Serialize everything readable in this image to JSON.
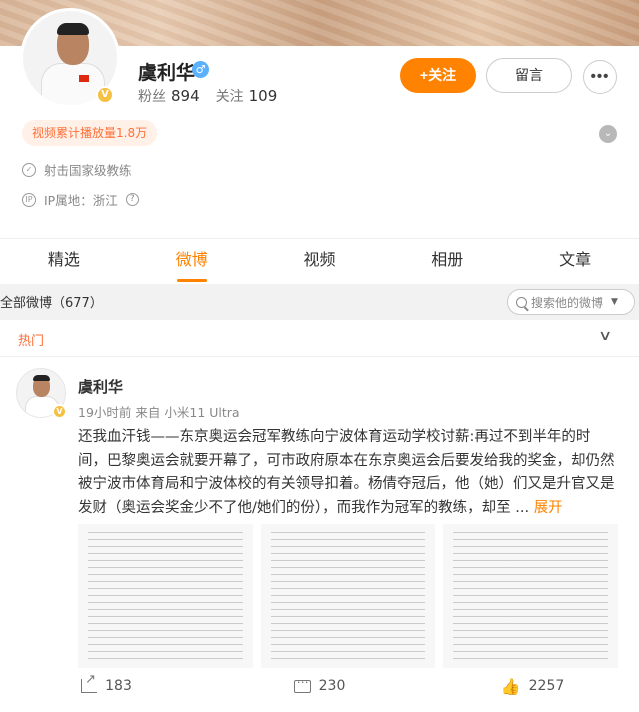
{
  "profile": {
    "name": "虞利华",
    "gender_icon": "♂",
    "verified_icon": "V",
    "fans_label": "粉丝",
    "fans_count": "894",
    "follow_label": "关注",
    "follow_count": "109",
    "follow_button": "+关注",
    "message_button": "留言",
    "more_button": "•••",
    "play_count_badge": "视频累计播放量1.8万",
    "expand_icon": "⌄",
    "info": [
      {
        "icon": "verified-shield-icon",
        "glyph": "✓",
        "text": "射击国家级教练"
      },
      {
        "icon": "ip-location-icon",
        "glyph": "IP",
        "text": "IP属地：浙江",
        "help": "?"
      }
    ]
  },
  "tabs": [
    {
      "label": "精选",
      "active": false
    },
    {
      "label": "微博",
      "active": true
    },
    {
      "label": "视频",
      "active": false
    },
    {
      "label": "相册",
      "active": false
    },
    {
      "label": "文章",
      "active": false
    }
  ],
  "feed": {
    "all_label": "全部微博（677）",
    "search_placeholder": "搜索他的微博",
    "search_caret": "▼",
    "hot_label": "热门",
    "hot_chevron": "∨"
  },
  "post": {
    "author": "虞利华",
    "time": "19小时前",
    "source": "来自 小米11 Ultra",
    "text": "还我血汗钱——东京奥运会冠军教练向宁波体育运动学校讨薪:再过不到半年的时间，巴黎奥运会就要开幕了，可市政府原本在东京奥运会后要发给我的奖金，却仍然被宁波市体育局和宁波体校的有关领导扣着。杨倩夺冠后，他（她）们又是升官又是发财（奥运会奖金少不了他/她们的份），而我作为冠军的教练，却至 ...",
    "expand_label": "展开",
    "images": [
      "document-page-1",
      "document-page-2",
      "document-page-3"
    ],
    "actions": {
      "share_count": "183",
      "comment_count": "230",
      "like_count": "2257"
    }
  },
  "colors": {
    "accent": "#ff8200",
    "badge_text": "#ff7037",
    "verified": "#f6c042",
    "gender": "#5cb1ff"
  }
}
